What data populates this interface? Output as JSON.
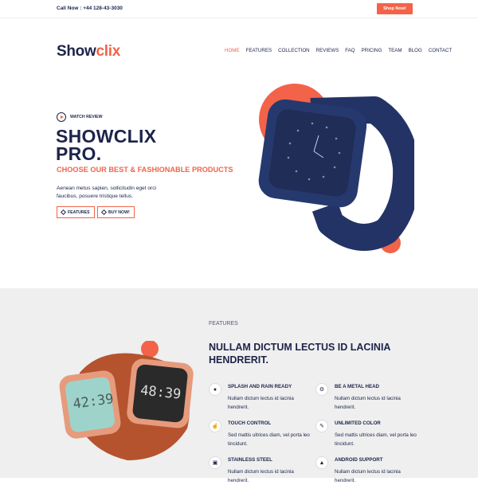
{
  "topbar": {
    "call": "Call Now : +44 128-43-3030",
    "shop_button": "Shop Now!"
  },
  "logo": {
    "part1": "Show",
    "part2": "clix"
  },
  "nav": [
    "HOME",
    "FEATURES",
    "COLLECTION",
    "REVIEWS",
    "FAQ",
    "PRICING",
    "TEAM",
    "BLOG",
    "CONTACT"
  ],
  "hero": {
    "watch_review": "WATCH REVIEW",
    "title_line1": "SHOWCLIX",
    "title_line2": "PRO.",
    "subtitle": "CHOOSE OUR BEST & FASHIONABLE PRODUCTS",
    "description": "Aenean metus sapien, sollicitudin eget orci faucibus, posuere tristique tellus.",
    "btn_features": "FEATURES",
    "btn_buy": "BUY NOW!"
  },
  "features": {
    "label": "FEATURES",
    "title": "NULLAM DICTUM LECTUS ID LACINIA HENDRERIT.",
    "items": [
      {
        "title": "SPLASH AND RAIN READY",
        "text": "Nullam dictum lectus id lacinia hendrerit.",
        "icon": "droplet-icon"
      },
      {
        "title": "BE A METAL HEAD",
        "text": "Nullam dictum lectus id lacinia hendrerit.",
        "icon": "gear-icon"
      },
      {
        "title": "TOUCH CONTROL",
        "text": "Sed mattis ultrices diam, vel porta leo tincidunt.",
        "icon": "hand-pointer-icon"
      },
      {
        "title": "UNLIMITED COLOR",
        "text": "Sed mattis ultrices diam, vel porta leo tincidunt.",
        "icon": "paintbrush-icon"
      },
      {
        "title": "STAINLESS STEEL",
        "text": "Nullam dictum lectus id lacinia hendrerit.",
        "icon": "stainless-icon"
      },
      {
        "title": "ANDROID SUPPORT",
        "text": "Nullam dictum lectus id lacinia hendrerit.",
        "icon": "android-icon"
      }
    ]
  },
  "colors": {
    "navy": "#1c2449",
    "accent": "#f26349",
    "section_bg": "#efefef"
  }
}
